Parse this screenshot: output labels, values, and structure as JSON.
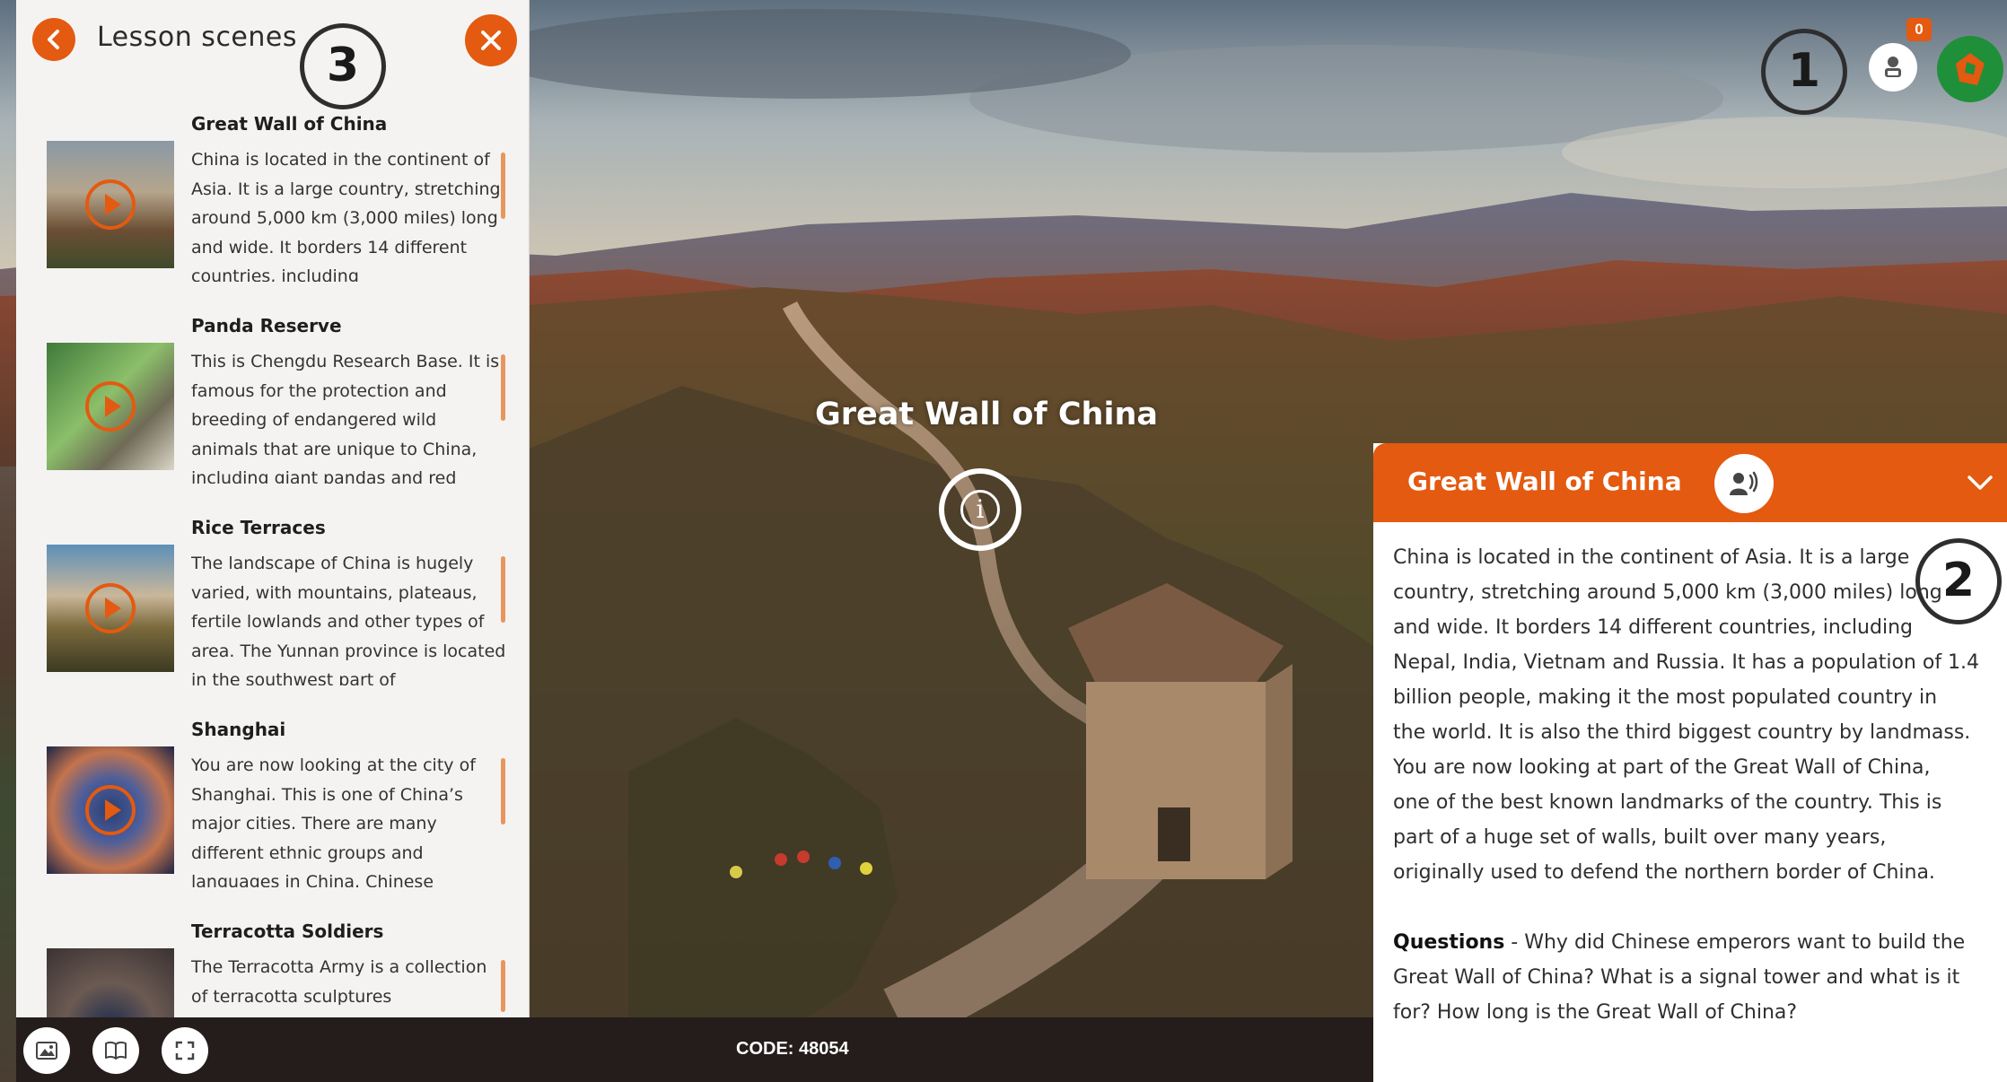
{
  "panel": {
    "title": "Lesson scenes",
    "scenes": [
      {
        "name": "Great Wall of China",
        "description": "China is located in the continent of Asia. It is a large country, stretching around 5,000 km (3,000 miles) long and wide. It borders 14 different countries, including"
      },
      {
        "name": "Panda Reserve",
        "description": "This is Chengdu Research Base. It is famous for the protection and breeding of endangered wild animals that are unique to China, including giant pandas and red"
      },
      {
        "name": "Rice Terraces",
        "description": "The landscape of China is hugely varied, with mountains, plateaus, fertile lowlands and other types of area. The Yunnan province is located in the southwest part of"
      },
      {
        "name": "Shanghai",
        "description": "You are now looking at the city of Shanghai. This is one of China’s major cities.  There are many different ethnic groups and languages in China. Chinese"
      },
      {
        "name": "Terracotta Soldiers",
        "description": "The Terracotta Army is a collection of terracotta sculptures"
      }
    ]
  },
  "toolbar": {
    "code": "CODE: 48054"
  },
  "hotspot": {
    "label": "Great Wall of China"
  },
  "topbar": {
    "badge_count": "0"
  },
  "callouts": {
    "one": "1",
    "two": "2",
    "three": "3"
  },
  "info_card": {
    "title": "Great Wall of China",
    "lines": [
      "China is located in the continent of Asia. It is a large",
      "country, stretching around 5,000 km (3,000 miles) long",
      "and wide. It borders 14 different countries, including",
      "Nepal, India, Vietnam and Russia. It has a population of 1.4",
      "billion people, making it the most populated country in",
      "the world. It is also the third biggest country by landmass.",
      "You are now looking at part of the Great Wall of China,",
      "one of the best known landmarks of the country. This is",
      "part of a huge set of walls, built over many years,",
      "originally used to defend the northern border of China."
    ],
    "questions_label": "Questions",
    "questions_lines": [
      " - Why did Chinese emperors want to build the",
      "Great Wall of China? What is a signal tower and what is it",
      "for? How long is the Great Wall of China?"
    ]
  },
  "colors": {
    "accent": "#e35a10",
    "panel_bg": "#f4f3f2",
    "toolbar_bg": "#241d1b",
    "logo_green": "#1f8f3a"
  },
  "icons": {
    "back": "chevron-left-icon",
    "close": "close-icon",
    "play": "play-icon",
    "gallery": "image-icon",
    "book": "book-icon",
    "fullscreen": "fullscreen-icon",
    "profile": "student-icon",
    "audio": "speaker-icon",
    "collapse": "chevron-down-icon",
    "info": "info-icon",
    "logo": "brand-logo-icon"
  }
}
